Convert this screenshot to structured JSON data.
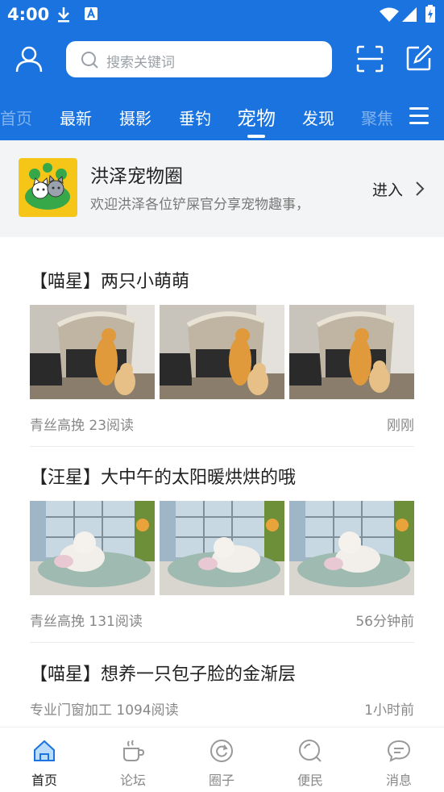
{
  "status": {
    "time": "4:00"
  },
  "search": {
    "placeholder": "搜索关键词"
  },
  "tabs": [
    {
      "label": "首页"
    },
    {
      "label": "最新"
    },
    {
      "label": "摄影"
    },
    {
      "label": "垂钓"
    },
    {
      "label": "宠物"
    },
    {
      "label": "发现"
    },
    {
      "label": "聚焦"
    }
  ],
  "circle": {
    "name": "洪泽宠物圈",
    "desc": "欢迎洪泽各位铲屎官分享宠物趣事，",
    "enter_label": "进入"
  },
  "posts": [
    {
      "title": "【喵星】两只小萌萌",
      "author_reads": "青丝高挽 23阅读",
      "time": "刚刚"
    },
    {
      "title": "【汪星】大中午的太阳暖烘烘的哦",
      "author_reads": "青丝高挽 131阅读",
      "time": "56分钟前"
    },
    {
      "title": "【喵星】想养一只包子脸的金渐层",
      "author_reads": "专业门窗加工 1094阅读",
      "time": "1小时前"
    }
  ],
  "bottom_nav": [
    {
      "label": "首页"
    },
    {
      "label": "论坛"
    },
    {
      "label": "圈子"
    },
    {
      "label": "便民"
    },
    {
      "label": "消息"
    }
  ],
  "colors": {
    "brand": "#1a73df",
    "logo_bg": "#f5c518"
  }
}
